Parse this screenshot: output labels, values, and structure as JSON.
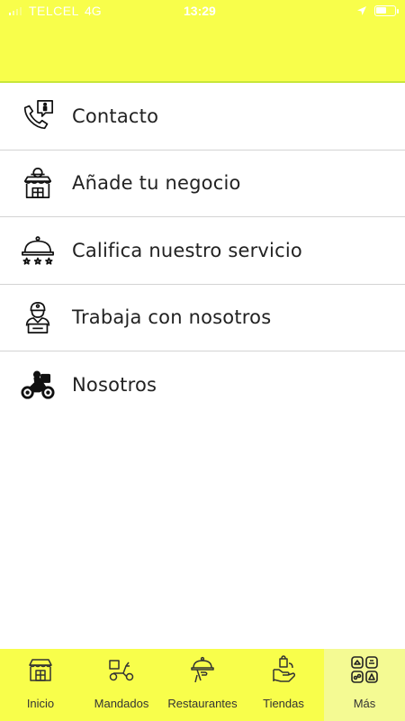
{
  "status_bar": {
    "carrier": "TELCEL",
    "network": "4G",
    "time": "13:29"
  },
  "menu": {
    "items": [
      {
        "label": "Contacto",
        "icon": "phone-contact-icon"
      },
      {
        "label": "Añade tu negocio",
        "icon": "storefront-icon"
      },
      {
        "label": "Califica nuestro servicio",
        "icon": "cloche-rating-icon"
      },
      {
        "label": "Trabaja con nosotros",
        "icon": "delivery-person-icon"
      },
      {
        "label": "Nosotros",
        "icon": "motorcycle-icon"
      }
    ]
  },
  "tabbar": {
    "active": "Más",
    "tabs": [
      {
        "label": "Inicio",
        "icon": "store-icon"
      },
      {
        "label": "Mandados",
        "icon": "scooter-icon"
      },
      {
        "label": "Restaurantes",
        "icon": "serving-hand-icon"
      },
      {
        "label": "Tiendas",
        "icon": "shopping-hand-icon"
      },
      {
        "label": "Más",
        "icon": "grid-more-icon"
      }
    ]
  },
  "colors": {
    "accent": "#f8fe4b",
    "active_tab": "#f4fa93",
    "divider": "#d4d4d4",
    "text": "#222222"
  }
}
